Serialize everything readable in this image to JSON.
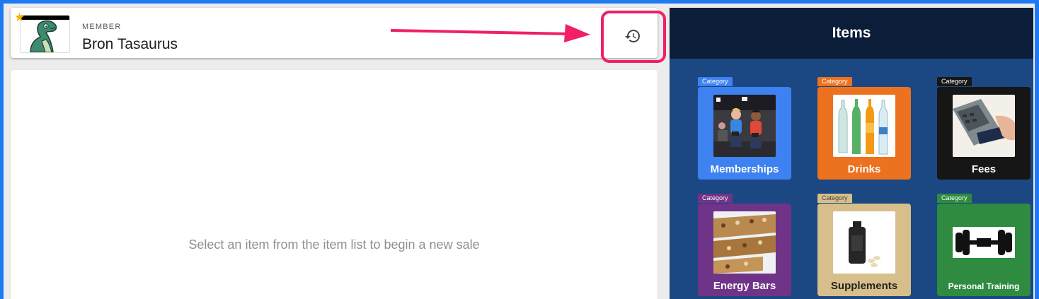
{
  "member": {
    "label": "MEMBER",
    "name": "Bron Tasaurus"
  },
  "sale": {
    "empty_message": "Select an item from the item list to begin a new sale"
  },
  "items": {
    "title": "Items",
    "categories": [
      {
        "tag": "Category",
        "label": "Memberships",
        "color": "#3d82f0",
        "tag_color": "#3d82f0",
        "icon": "fitness-class-photo"
      },
      {
        "tag": "Category",
        "label": "Drinks",
        "color": "#ec7220",
        "tag_color": "#ec7220",
        "icon": "bottles-photo"
      },
      {
        "tag": "Category",
        "label": "Fees",
        "color": "#161616",
        "tag_color": "#161616",
        "icon": "card-terminal-photo"
      },
      {
        "tag": "Category",
        "label": "Energy Bars",
        "color": "#6f3387",
        "tag_color": "#6f3387",
        "icon": "energy-bars-photo"
      },
      {
        "tag": "Category",
        "label": "Supplements",
        "color": "#d6bf8a",
        "tag_color": "#d6bf8a",
        "icon": "supplement-bottle-photo"
      },
      {
        "tag": "Category",
        "label": "Personal Training",
        "color": "#2e8b3f",
        "tag_color": "#2e8b3f",
        "icon": "dumbbell-photo"
      }
    ]
  },
  "colors": {
    "accent_highlight": "#f01f67",
    "items_header_bg": "#0b1d38",
    "items_panel_bg": "#1b4782",
    "outer_border": "#1e7af2"
  }
}
